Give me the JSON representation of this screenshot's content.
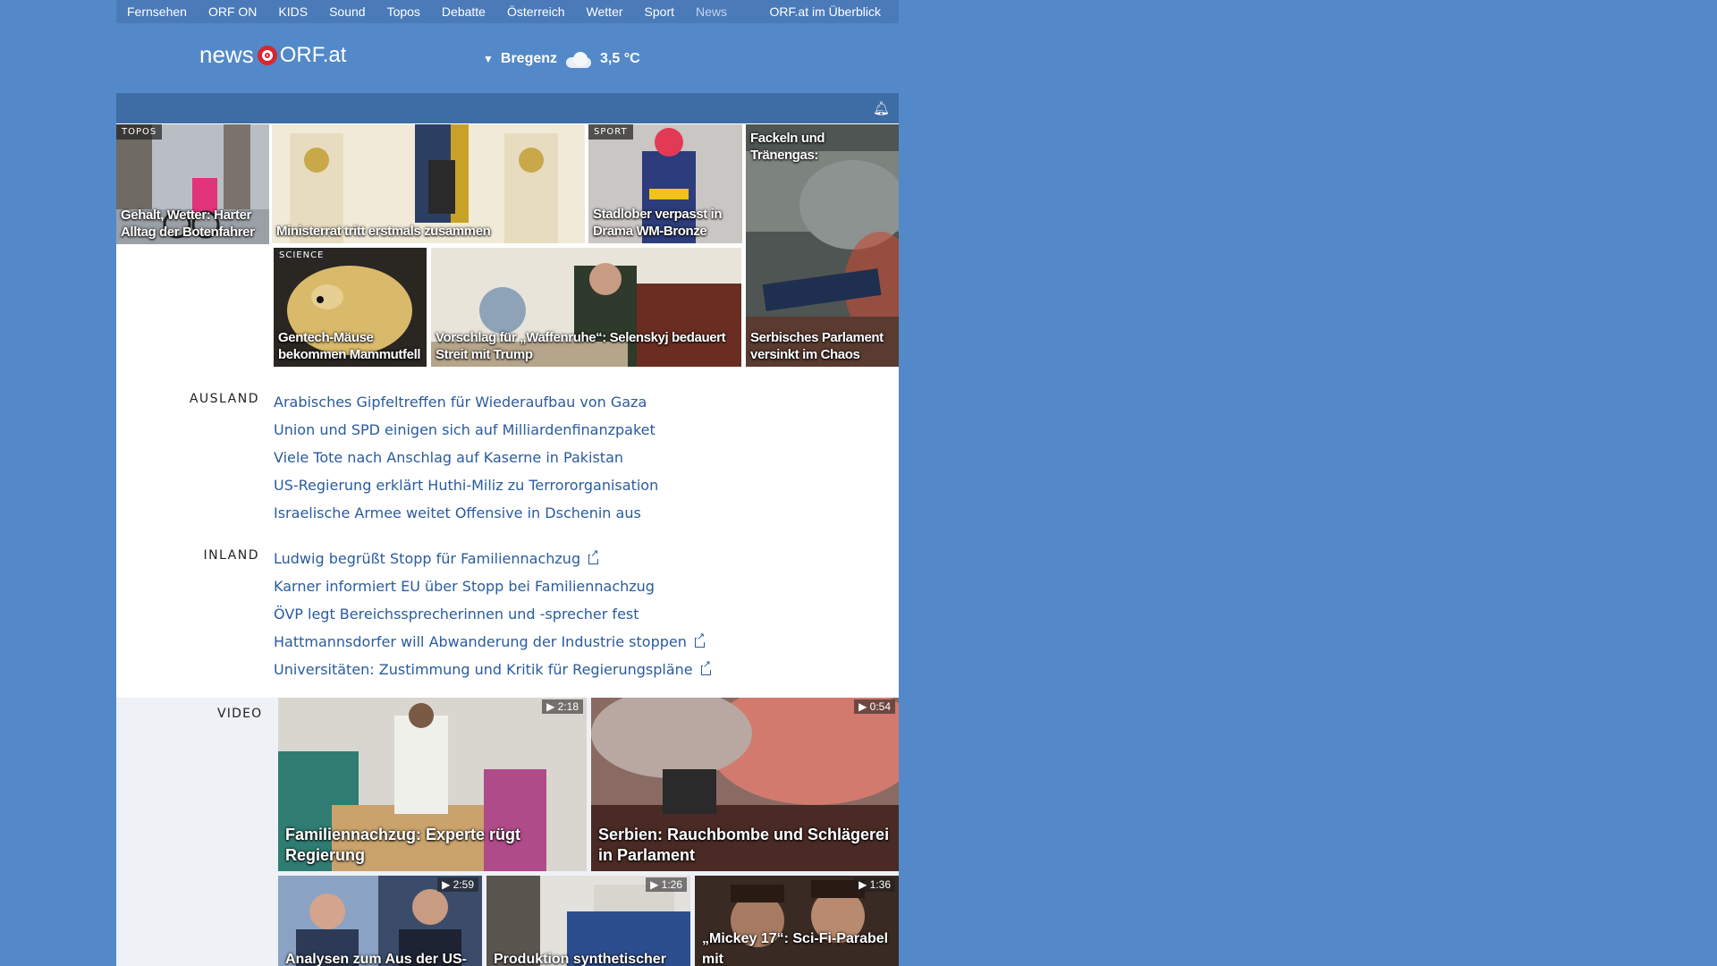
{
  "topnav": {
    "items": [
      "Fernsehen",
      "ORF ON",
      "KIDS",
      "Sound",
      "Topos",
      "Debatte",
      "Österreich",
      "Wetter",
      "Sport",
      "News"
    ],
    "active": "News",
    "overview": "ORF.at im Überblick"
  },
  "header": {
    "logo_news": "news",
    "logo_orf": "ORF.at",
    "weather": {
      "location": "Bregenz",
      "temperature": "3,5 °C",
      "icon": "cloud-icon"
    }
  },
  "teasers": [
    {
      "tag": "TOPOS",
      "title": "Gehalt, Wetter: Harter Alltag der Botenfahrer"
    },
    {
      "tag": "",
      "title": "Ministerrat tritt erstmals zusammen"
    },
    {
      "tag": "SPORT",
      "title": "Stadlober verpasst in Drama WM-Bronze"
    },
    {
      "tag": "",
      "title": "Fackeln und Tränengas: Serbisches Parlament versinkt in Chaos",
      "title_top": "Fackeln und Tränengas:",
      "title_bottom": "Serbisches Parlament versinkt im Chaos"
    },
    {
      "tag": "SCIENCE",
      "title": "Gentech-Mäuse bekommen Mammutfell"
    },
    {
      "tag": "",
      "title": "Vorschlag für „Waffenruhe“: Selenskyj bedauert Streit mit Trump"
    }
  ],
  "sections": {
    "ausland": {
      "label": "AUSLAND",
      "items": [
        {
          "text": "Arabisches Gipfeltreffen für Wiederaufbau von Gaza",
          "external": false
        },
        {
          "text": "Union und SPD einigen sich auf Milliardenfinanzpaket",
          "external": false
        },
        {
          "text": "Viele Tote nach Anschlag auf Kaserne in Pakistan",
          "external": false
        },
        {
          "text": "US-Regierung erklärt Huthi-Miliz zu Terrororganisation",
          "external": false
        },
        {
          "text": "Israelische Armee weitet Offensive in Dschenin aus",
          "external": false
        }
      ]
    },
    "inland": {
      "label": "INLAND",
      "items": [
        {
          "text": "Ludwig begrüßt Stopp für Familiennachzug",
          "external": true
        },
        {
          "text": "Karner informiert EU über Stopp bei Familiennachzug",
          "external": false
        },
        {
          "text": "ÖVP legt Bereichssprecherinnen und -sprecher fest",
          "external": false
        },
        {
          "text": "Hattmannsdorfer will Abwanderung der Industrie stoppen",
          "external": true
        },
        {
          "text": "Universitäten: Zustimmung und Kritik für Regierungspläne",
          "external": true
        }
      ]
    }
  },
  "video": {
    "label": "VIDEO",
    "items": [
      {
        "title": "Familiennachzug: Experte rügt Regierung",
        "duration": "2:18"
      },
      {
        "title": "Serbien: Rauchbombe und Schlägerei in Parlament",
        "duration": "0:54"
      },
      {
        "title": "Analysen zum Aus der US-",
        "duration": "2:59"
      },
      {
        "title": "Produktion synthetischer",
        "duration": "1:26"
      },
      {
        "title": "„Mickey 17“: Sci-Fi-Parabel mit",
        "duration": "1:36"
      }
    ]
  },
  "colors": {
    "background": "#5389c8",
    "link": "#2a5b9e",
    "logo_red": "#d8262e"
  }
}
